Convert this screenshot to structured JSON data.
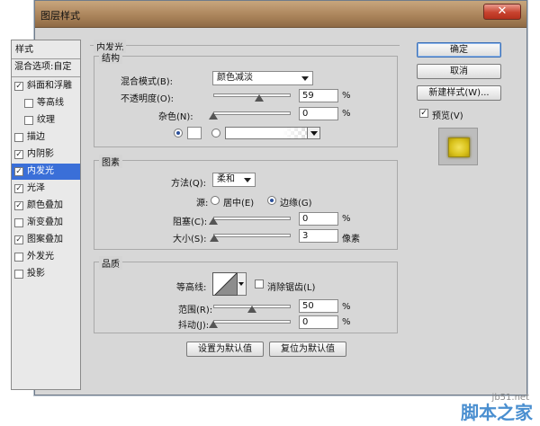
{
  "window": {
    "title": "图层样式",
    "close_glyph": "✕"
  },
  "style_list": {
    "header": "样式",
    "blend_options": "混合选项:自定",
    "items": [
      {
        "label": "斜面和浮雕",
        "checked": true,
        "indent": false
      },
      {
        "label": "等高线",
        "checked": false,
        "indent": true
      },
      {
        "label": "纹理",
        "checked": false,
        "indent": true
      },
      {
        "label": "描边",
        "checked": false,
        "indent": false
      },
      {
        "label": "内阴影",
        "checked": true,
        "indent": false
      },
      {
        "label": "内发光",
        "checked": true,
        "indent": false,
        "selected": true
      },
      {
        "label": "光泽",
        "checked": true,
        "indent": false
      },
      {
        "label": "颜色叠加",
        "checked": true,
        "indent": false
      },
      {
        "label": "渐变叠加",
        "checked": false,
        "indent": false
      },
      {
        "label": "图案叠加",
        "checked": true,
        "indent": false
      },
      {
        "label": "外发光",
        "checked": false,
        "indent": false
      },
      {
        "label": "投影",
        "checked": false,
        "indent": false
      }
    ]
  },
  "inner_glow": {
    "title": "内发光",
    "structure": {
      "title": "结构",
      "blend_mode_label": "混合模式(B):",
      "blend_mode_value": "颜色减淡",
      "opacity_label": "不透明度(O):",
      "opacity_value": "59",
      "opacity_unit": "%",
      "noise_label": "杂色(N):",
      "noise_value": "0",
      "noise_unit": "%",
      "color_swatch": "#ffffff"
    },
    "elements": {
      "title": "图素",
      "technique_label": "方法(Q):",
      "technique_value": "柔和",
      "source_label": "源:",
      "source_center": "居中(E)",
      "source_edge": "边缘(G)",
      "choke_label": "阻塞(C):",
      "choke_value": "0",
      "choke_unit": "%",
      "size_label": "大小(S):",
      "size_value": "3",
      "size_unit": "像素"
    },
    "quality": {
      "title": "品质",
      "contour_label": "等高线:",
      "anti_alias_label": "消除锯齿(L)",
      "range_label": "范围(R):",
      "range_value": "50",
      "range_unit": "%",
      "jitter_label": "抖动(J):",
      "jitter_value": "0",
      "jitter_unit": "%"
    },
    "make_default": "设置为默认值",
    "reset_default": "复位为默认值"
  },
  "buttons": {
    "ok": "确定",
    "cancel": "取消",
    "new_style": "新建样式(W)...",
    "preview_label": "预览(V)"
  },
  "watermark": {
    "site": "jb51.net",
    "brand": "脚本之家"
  }
}
